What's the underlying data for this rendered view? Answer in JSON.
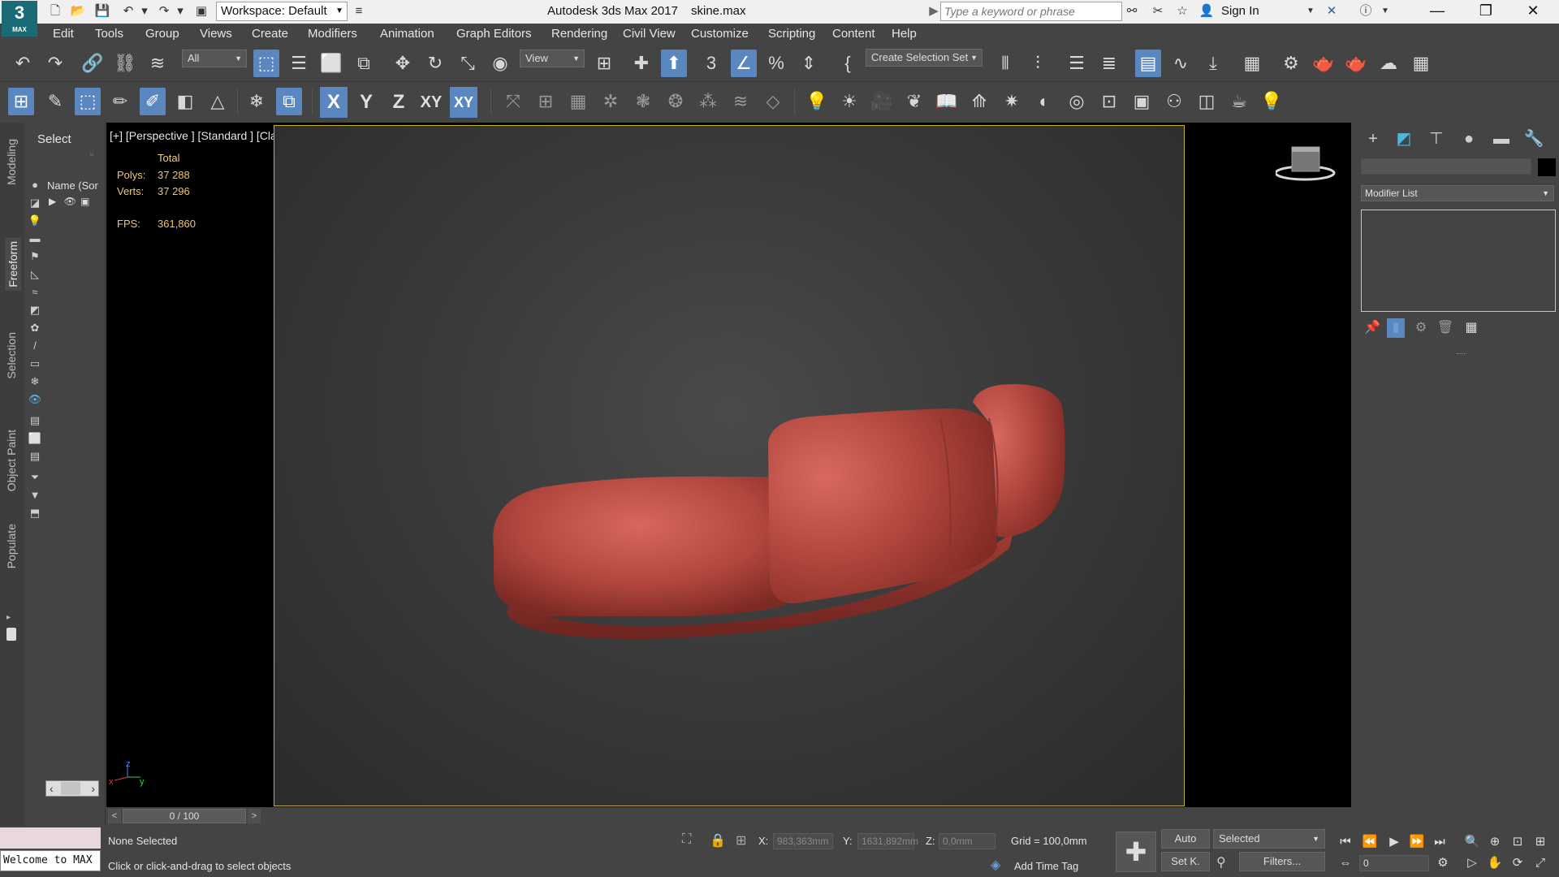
{
  "titlebar": {
    "app_title": "Autodesk 3ds Max 2017",
    "file_name": "skine.max",
    "workspace": "Workspace: Default",
    "search_placeholder": "Type a keyword or phrase",
    "sign_in": "Sign In",
    "logo_num": "3",
    "logo_sub": "MAX"
  },
  "menu": [
    "Edit",
    "Tools",
    "Group",
    "Views",
    "Create",
    "Modifiers",
    "Animation",
    "Graph Editors",
    "Rendering",
    "Civil View",
    "Customize",
    "Scripting",
    "Content",
    "Help"
  ],
  "toolbar": {
    "selection_filter": "All",
    "ref_coord": "View",
    "selection_set": "Create Selection Set",
    "axis_x": "X",
    "axis_y": "Y",
    "axis_z": "Z",
    "axis_xy": "XY",
    "axis_xy2": "XY"
  },
  "left_tabs": [
    "Modeling",
    "Freeform",
    "Selection",
    "Object Paint",
    "Populate"
  ],
  "scene_explorer": {
    "title": "Select",
    "column": "Name (Sor"
  },
  "viewport": {
    "label": "[+] [Perspective ] [Standard ] [Clay ]",
    "stats_total": "Total",
    "polys_label": "Polys:",
    "polys_value": "37 288",
    "verts_label": "Verts:",
    "verts_value": "37 296",
    "fps_label": "FPS:",
    "fps_value": "361,860",
    "gizmo_x": "x",
    "gizmo_y": "y",
    "gizmo_z": "z"
  },
  "command_panel": {
    "modifier_list": "Modifier List"
  },
  "timeslider": {
    "frame": "0 / 100"
  },
  "status": {
    "maxscript_text": "Welcome to MAX",
    "selection": "None Selected",
    "prompt": "Click or click-and-drag to select objects",
    "x_label": "X:",
    "x_value": "983,363mm",
    "y_label": "Y:",
    "y_value": "1631,892mm",
    "z_label": "Z:",
    "z_value": "0,0mm",
    "grid": "Grid = 100,0mm",
    "add_time_tag": "Add Time Tag",
    "auto": "Auto",
    "set_key": "Set K.",
    "selected": "Selected",
    "filters": "Filters...",
    "frame_field": "0"
  },
  "colors": {
    "accent": "#5b87c1",
    "viewport_border": "#c8b040",
    "stats": "#f0c766",
    "sofa": "#b5473e"
  }
}
